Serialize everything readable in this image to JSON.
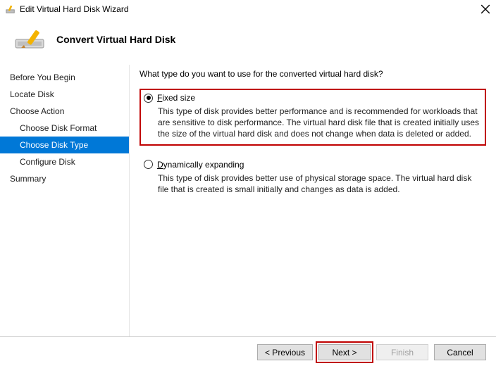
{
  "titlebar": {
    "title": "Edit Virtual Hard Disk Wizard"
  },
  "header": {
    "title": "Convert Virtual Hard Disk"
  },
  "steps": [
    {
      "label": "Before You Begin",
      "sub": false,
      "selected": false
    },
    {
      "label": "Locate Disk",
      "sub": false,
      "selected": false
    },
    {
      "label": "Choose Action",
      "sub": false,
      "selected": false
    },
    {
      "label": "Choose Disk Format",
      "sub": true,
      "selected": false
    },
    {
      "label": "Choose Disk Type",
      "sub": true,
      "selected": true
    },
    {
      "label": "Configure Disk",
      "sub": true,
      "selected": false
    },
    {
      "label": "Summary",
      "sub": false,
      "selected": false
    }
  ],
  "content": {
    "question": "What type do you want to use for the converted virtual hard disk?",
    "options": [
      {
        "label": "Fixed size",
        "checked": true,
        "highlighted": true,
        "description": "This type of disk provides better performance and is recommended for workloads that are sensitive to disk performance. The virtual hard disk file that is created initially uses the size of the virtual hard disk and does not change when data is deleted or added."
      },
      {
        "label": "Dynamically expanding",
        "checked": false,
        "highlighted": false,
        "description": "This type of disk provides better use of physical storage space. The virtual hard disk file that is created is small initially and changes as data is added."
      }
    ]
  },
  "footer": {
    "previous": "< Previous",
    "next": "Next >",
    "finish": "Finish",
    "cancel": "Cancel"
  }
}
